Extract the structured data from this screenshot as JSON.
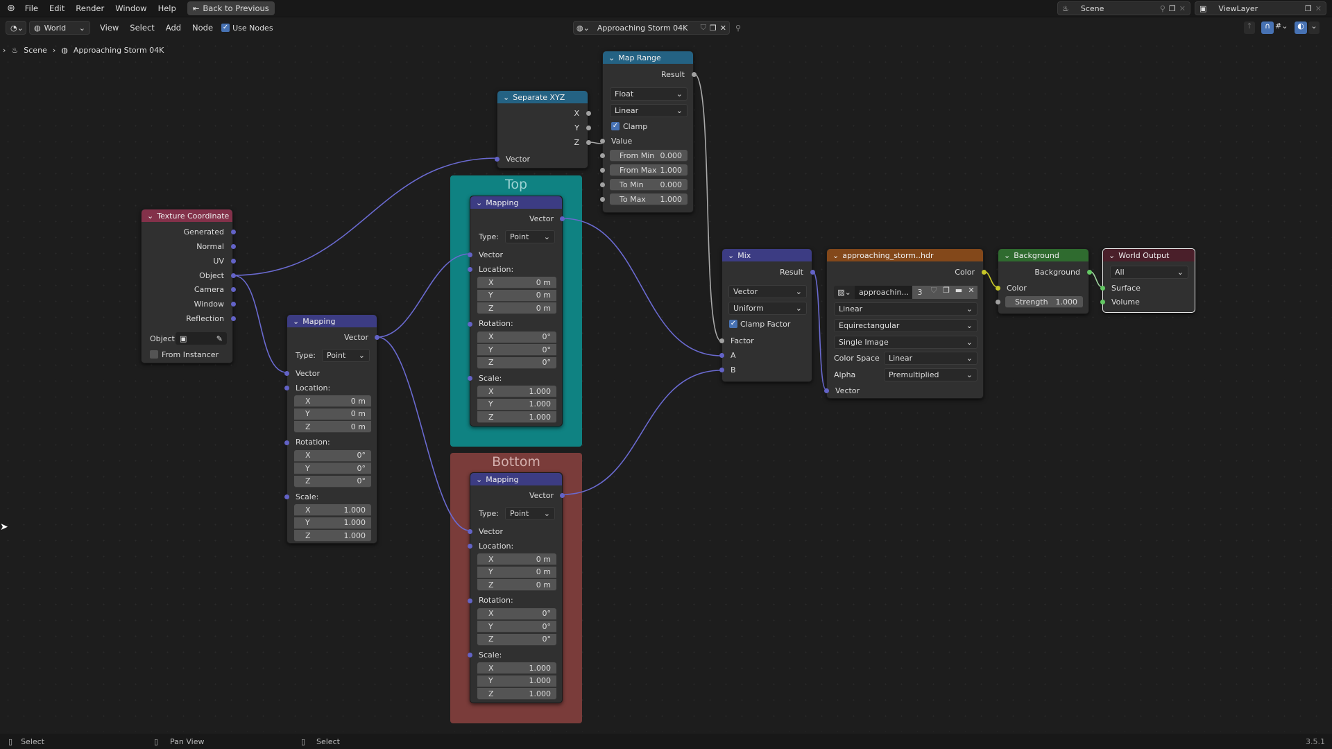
{
  "menu": {
    "items": [
      "File",
      "Edit",
      "Render",
      "Window",
      "Help"
    ],
    "back": "Back to Previous"
  },
  "scene": {
    "label": "Scene",
    "viewlayer": "ViewLayer"
  },
  "header": {
    "editor": "World",
    "items": [
      "View",
      "Select",
      "Add",
      "Node"
    ],
    "use_nodes": "Use Nodes",
    "world_name": "Approaching Storm 04K"
  },
  "breadcrumb": {
    "scene": "Scene",
    "world": "Approaching Storm 04K"
  },
  "texcoord": {
    "title": "Texture Coordinate",
    "outputs": [
      "Generated",
      "Normal",
      "UV",
      "Object",
      "Camera",
      "Window",
      "Reflection"
    ],
    "object_label": "Object:",
    "from_instancer": "From Instancer"
  },
  "mapping": {
    "title": "Mapping",
    "out": "Vector",
    "type_label": "Type:",
    "type": "Point",
    "vec": "Vector",
    "loc": "Location:",
    "rot": "Rotation:",
    "scale": "Scale:",
    "axes": [
      "X",
      "Y",
      "Z"
    ],
    "loc_vals": [
      "0 m",
      "0 m",
      "0 m"
    ],
    "rot_vals": [
      "0°",
      "0°",
      "0°"
    ],
    "scale_vals": [
      "1.000",
      "1.000",
      "1.000"
    ]
  },
  "sepxyz": {
    "title": "Separate XYZ",
    "outs": [
      "X",
      "Y",
      "Z"
    ],
    "in": "Vector"
  },
  "maprange": {
    "title": "Map Range",
    "out": "Result",
    "dtype": "Float",
    "interp": "Linear",
    "clamp": "Clamp",
    "value": "Value",
    "fields": [
      {
        "l": "From Min",
        "v": "0.000"
      },
      {
        "l": "From Max",
        "v": "1.000"
      },
      {
        "l": "To Min",
        "v": "0.000"
      },
      {
        "l": "To Max",
        "v": "1.000"
      }
    ]
  },
  "frames": {
    "top": "Top",
    "bottom": "Bottom"
  },
  "mix": {
    "title": "Mix",
    "out": "Result",
    "dtype": "Vector",
    "mode": "Uniform",
    "clamp": "Clamp Factor",
    "ins": [
      "Factor",
      "A",
      "B"
    ]
  },
  "image": {
    "title": "approaching_storm..hdr",
    "out": "Color",
    "name": "approachin...",
    "users": "3",
    "interp": "Linear",
    "proj": "Equirectangular",
    "source": "Single Image",
    "cs_label": "Color Space",
    "cs": "Linear",
    "alpha_label": "Alpha",
    "alpha": "Premultiplied",
    "in": "Vector"
  },
  "background": {
    "title": "Background",
    "out": "Background",
    "color": "Color",
    "strength_label": "Strength",
    "strength": "1.000"
  },
  "worldout": {
    "title": "World Output",
    "target": "All",
    "ins": [
      "Surface",
      "Volume"
    ]
  },
  "status": {
    "left": "Select",
    "mid": "Pan View",
    "right": "Select",
    "version": "3.5.1"
  }
}
